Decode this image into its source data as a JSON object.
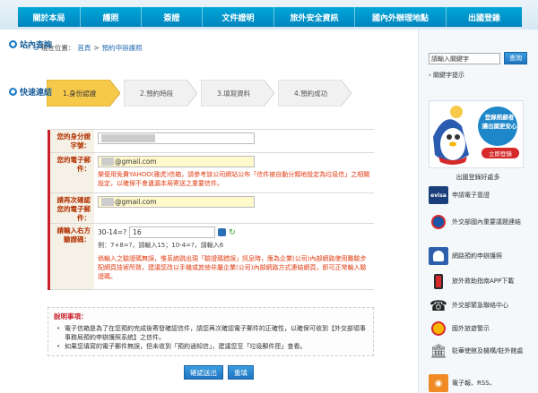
{
  "nav": [
    "關於本局",
    "護照",
    "簽證",
    "文件證明",
    "旅外安全資訊",
    "國內外辦理地點",
    "出國登錄"
  ],
  "breadcrumb": {
    "prefix": "現在位置：",
    "home": "首頁",
    "sep": ">",
    "current": "預約申辦護照"
  },
  "steps": [
    "1.身份認證",
    "2.預約時段",
    "3.填寫資料",
    "4.預約成功"
  ],
  "form": {
    "id_label": "您的身分證字號：",
    "email_label": "您的電子郵件：",
    "email_value": "@gmail.com",
    "email_warning": "樂便用免費YAHOO(雅虎)信箱，請參考該公司網站公布「信件被自動分類地設定為垃圾信」之相關設定，以確保不會遺漏本局寄送之重要信件。",
    "confirm_label": "請再次確認您的電子郵件：",
    "confirm_value": "@gmail.com",
    "captcha_label": "請輸入右方驗證碼：",
    "captcha_question": "30-14=?",
    "captcha_answer": "16",
    "captcha_hint": "例：7+8=?，請輸入15；10-4=?，請輸入6",
    "captcha_warning": "倘輸入之驗證碼無誤，惟系統跳出現「驗證碼錯誤」訊息時，應為企業(公司)內部網路使用難驗步配網頁技術所致，建議您改以手機或其他非屬企業(公司)內部網路方式連結網頁，即可正常輸入驗證碼。"
  },
  "notes": {
    "title": "說明事項：",
    "items": [
      "電子信箱是為了在您預約完成後寄發確認信件，請您再次確認電子郵件的正確性，以確保可收到【外交部領事事務局預約申辦護照系統】之信件。",
      "如果您填寫的電子郵件無誤，但未收到「預約通知信」，建議您至「垃圾郵件匣」查看。"
    ]
  },
  "buttons": {
    "submit": "確認送出",
    "reset": "重填"
  },
  "sidebar": {
    "search_title": "站內查詢",
    "search_placeholder": "請輸入關鍵字",
    "search_button": "查詢",
    "keyword_hint": "關鍵字提示",
    "quicklinks_title": "快速連結",
    "banner_text": "登錄照顧者\n讓出國更安心",
    "banner_button": "立即登錄",
    "banner_caption": "出國登錄好處多",
    "links": [
      "申請電子簽證",
      "外交部國內重要議題連結",
      "網路預約申辦護照",
      "旅外救助指南APP下載",
      "外交部緊急聯絡中心",
      "國外旅遊警示",
      "駐華使館及機構/駐外館處",
      "電子報、RSS、"
    ]
  },
  "colors": {
    "nav": "#0094ca",
    "accent_red": "#c8202a",
    "warning": "#e03a10",
    "label_bg": "#f6f1e6",
    "link": "#2a6fb5"
  }
}
